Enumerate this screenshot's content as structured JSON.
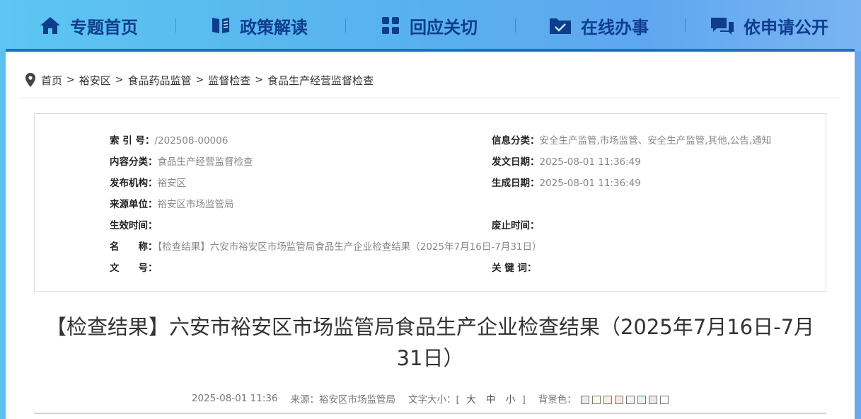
{
  "nav": {
    "items": [
      {
        "label": "专题首页",
        "icon": "home-icon"
      },
      {
        "label": "政策解读",
        "icon": "book-icon"
      },
      {
        "label": "回应关切",
        "icon": "grid-icon"
      },
      {
        "label": "在线办事",
        "icon": "folder-check-icon"
      },
      {
        "label": "依申请公开",
        "icon": "chat-icon"
      }
    ],
    "color": "#0e3d8c"
  },
  "breadcrumb": {
    "items": [
      "首页",
      "裕安区",
      "食品药品监管",
      "监督检查",
      "食品生产经营监督检查"
    ],
    "separator": ">"
  },
  "meta": {
    "left": [
      {
        "label": "索 引 号：",
        "value": "/202508-00006"
      },
      {
        "label": "内容分类：",
        "value": "食品生产经营监督检查"
      },
      {
        "label": "发布机构：",
        "value": "裕安区"
      },
      {
        "label": "来源单位：",
        "value": "裕安区市场监管局"
      },
      {
        "label": "生效时间：",
        "value": ""
      },
      {
        "label": "名　　称：",
        "value": "【检查结果】六安市裕安区市场监管局食品生产企业检查结果（2025年7月16日-7月31日）"
      },
      {
        "label": "文　　号：",
        "value": ""
      }
    ],
    "right": [
      {
        "label": "信息分类：",
        "value": "安全生产监管,市场监管、安全生产监管,其他,公告,通知"
      },
      {
        "label": "发文日期：",
        "value": "2025-08-01 11:36:49"
      },
      {
        "label": "生成日期：",
        "value": "2025-08-01 11:36:49"
      },
      {
        "label": "废止时间：",
        "value": ""
      },
      {
        "label": "关 键 词：",
        "value": ""
      }
    ]
  },
  "article": {
    "title_line1": "【检查结果】六安市裕安区市场监管局食品生产企业检查结果（2025年7月16日-7月",
    "title_line2": "31日）",
    "date": "2025-08-01 11:36",
    "source": "来源：裕安区市场监管局",
    "font_size_label": "文字大小：[",
    "font_size_close": "]",
    "font_sizes": [
      "大",
      "中",
      "小"
    ],
    "bg_label": "背景色：",
    "bg_colors": [
      "#e8eaf6",
      "#fdfde5",
      "#fdeee0",
      "#fde4e4",
      "#eef6e4",
      "#e4f5f5",
      "#e9e9e9",
      "#ffffff"
    ]
  }
}
